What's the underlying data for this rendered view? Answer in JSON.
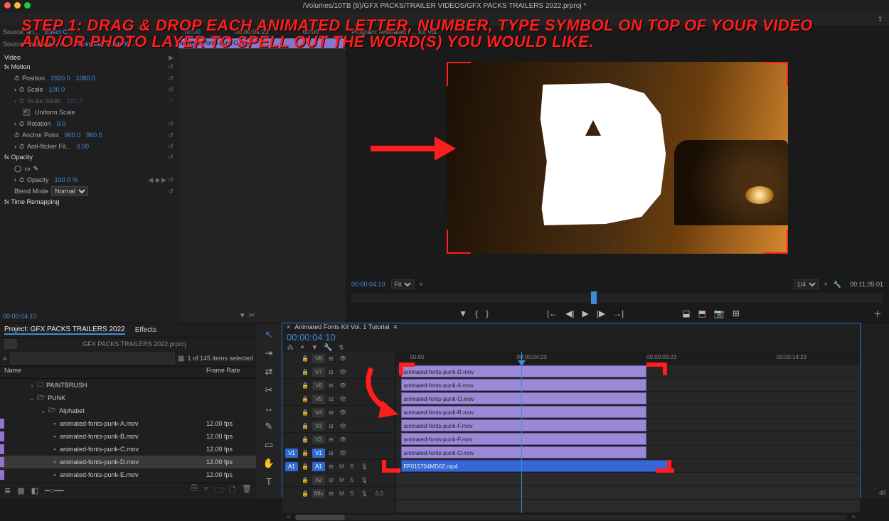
{
  "titlebar": {
    "path": "/Volumes/10TB (8)/GFX PACKS/TRAILER VIDEOS/GFX PACKS TRAILERS 2022.prproj *",
    "dots": [
      "#ff5f57",
      "#febc2e",
      "#28c840"
    ]
  },
  "overlay": "STEP 1: DRAG & DROP EACH ANIMATED LETTER, NUMBER, TYPE SYMBOL ON TOP OF YOUR VIDEO AND/OR PHOTO LAYER TO SPELL OUT THE WORD(S) YOU WOULD LIKE.",
  "effect_controls": {
    "tabs": {
      "source": "Source: an...",
      "ec": "Effect C..."
    },
    "clip_tab": "Source * animated-fo...",
    "seq_tab": "Animated Fonts Ki...",
    "mini_ruler": {
      "a": ":00:00",
      "b": "00:00:04:23",
      "c": "00:00"
    },
    "mini_clip": "animated-fonts-punk-O.mov",
    "sections": {
      "video": "Video",
      "motion": "Motion",
      "position": {
        "label": "Position",
        "x": "1920.0",
        "y": "1080.0"
      },
      "scale": {
        "label": "Scale",
        "val": "100.0"
      },
      "scalew": {
        "label": "Scale Width",
        "val": "100.0"
      },
      "uniform": "Uniform Scale",
      "rotation": {
        "label": "Rotation",
        "val": "0.0"
      },
      "anchor": {
        "label": "Anchor Point",
        "x": "960.0",
        "y": "960.0"
      },
      "flicker": {
        "label": "Anti-flicker Fil...",
        "val": "0.00"
      },
      "opacity_h": "Opacity",
      "opacity": {
        "label": "Opacity",
        "val": "100.0 %"
      },
      "blend": {
        "label": "Blend Mode",
        "val": "Normal"
      },
      "timeremp": "Time Remapping"
    },
    "tc": "00:00:04:10"
  },
  "program": {
    "tab": "Program: Animated F... Kit Vol...",
    "tc_left": "00:00:04:10",
    "fit": "Fit",
    "zoom": "1/4",
    "dur": "00:11:35:01",
    "transport": [
      "add-marker",
      "in",
      "out",
      "goto-in",
      "step-back",
      "play",
      "step-fwd",
      "goto-out",
      "lift",
      "extract",
      "export-frame",
      "btn-editor"
    ]
  },
  "project": {
    "tabs": {
      "project": "Project: GFX PACKS TRAILERS 2022",
      "effects": "Effects"
    },
    "proj_name": "GFX PACKS TRAILERS 2022.prproj",
    "count": "1 of 145 items selected",
    "cols": {
      "name": "Name",
      "fps": "Frame Rate"
    },
    "items": [
      {
        "type": "folder",
        "chip": "",
        "name": "PAINTBRUSH",
        "fps": "",
        "ind": 1
      },
      {
        "type": "folder-open",
        "chip": "",
        "name": "PUNK",
        "fps": "",
        "ind": 1
      },
      {
        "type": "folder-open",
        "chip": "",
        "name": "Alphabet",
        "fps": "",
        "ind": 2
      },
      {
        "type": "clip",
        "chip": "purple",
        "name": "animated-fonts-punk-A.mov",
        "fps": "12.00 fps",
        "ind": 3
      },
      {
        "type": "clip",
        "chip": "purple",
        "name": "animated-fonts-punk-B.mov",
        "fps": "12.00 fps",
        "ind": 3
      },
      {
        "type": "clip",
        "chip": "purple",
        "name": "animated-fonts-punk-C.mov",
        "fps": "12.00 fps",
        "ind": 3
      },
      {
        "type": "clip",
        "chip": "purple",
        "name": "animated-fonts-punk-D.mov",
        "fps": "12.00 fps",
        "ind": 3,
        "sel": true
      },
      {
        "type": "clip",
        "chip": "purple",
        "name": "animated-fonts-punk-E.mov",
        "fps": "12.00 fps",
        "ind": 3
      }
    ],
    "bottom_icons": [
      "list",
      "thumb",
      "free",
      "auto",
      "gap",
      "search",
      "new-bin",
      "new-item",
      "trash"
    ]
  },
  "tools": [
    "select",
    "track-fwd",
    "ripple",
    "rolling",
    "rate",
    "slip",
    "pen",
    "rect",
    "hand",
    "type"
  ],
  "timeline": {
    "seq_name": "Animated Fonts Kit Vol. 1 Tutorial",
    "tc": "00:00:04:10",
    "ruler": {
      "a": "00:00",
      "b": "00:00:04:23",
      "c": "00:00:09:23",
      "d": "00:00:14:23"
    },
    "tracks": [
      {
        "name": "V8",
        "clip": "animated-fonts-punk-D.mov"
      },
      {
        "name": "V7",
        "clip": "animated-fonts-punk-A.mov"
      },
      {
        "name": "V6",
        "clip": "animated-fonts-punk-O.mov"
      },
      {
        "name": "V5",
        "clip": "animated-fonts-punk-R.mov"
      },
      {
        "name": "V4",
        "clip": "animated-fonts-punk-F.mov"
      },
      {
        "name": "V3",
        "clip": "animated-fonts-punk-F.mov"
      },
      {
        "name": "V2",
        "clip": "animated-fonts-punk-O.mov"
      },
      {
        "name": "V1",
        "clip": "FP015704MD02.mp4",
        "blue": true,
        "src": "V1"
      }
    ],
    "audio": [
      {
        "name": "A1",
        "src": "A1"
      },
      {
        "name": "A2"
      },
      {
        "name": "Mix",
        "mix": "0.0"
      }
    ]
  }
}
